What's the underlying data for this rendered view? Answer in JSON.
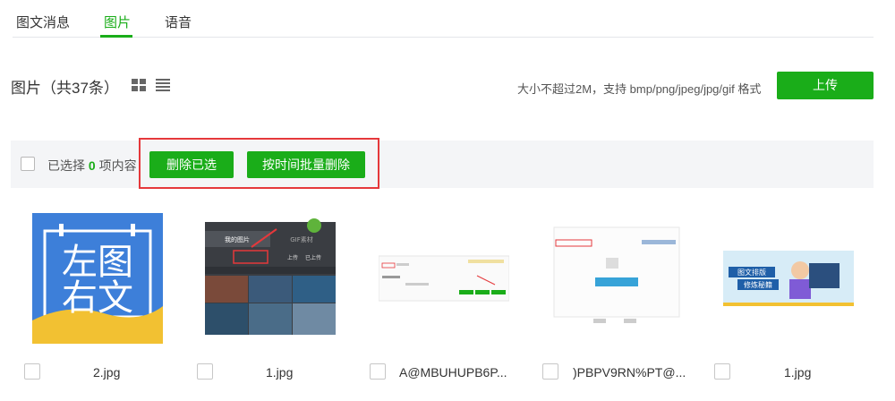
{
  "tabs": [
    {
      "label": "图文消息"
    },
    {
      "label": "图片"
    },
    {
      "label": "语音"
    }
  ],
  "active_tab": "图片",
  "header": {
    "title": "图片（共37条）",
    "hint": "大小不超过2M，支持 bmp/png/jpeg/jpg/gif 格式",
    "upload_label": "上传"
  },
  "selection_bar": {
    "prefix": "已选择 ",
    "count": "0",
    "suffix": " 项内容",
    "delete_selected_label": "删除已选",
    "batch_delete_label": "按时间批量删除"
  },
  "thumbs": {
    "t1": {
      "line1": "左图",
      "line2": "右文"
    },
    "t2": {
      "tab1": "我的图片",
      "tab2": "GIF素材",
      "action": "上传",
      "action2": "已上传"
    },
    "t5": {
      "line1": "图文排版",
      "line2": "修炼秘籍"
    }
  },
  "items": [
    {
      "name": "2.jpg"
    },
    {
      "name": "1.jpg"
    },
    {
      "name": "A@MBUHUPB6P..."
    },
    {
      "name": ")PBPV9RN%PT@..."
    },
    {
      "name": "1.jpg"
    }
  ],
  "colors": {
    "accent": "#1aad19",
    "highlight": "#e5383b"
  }
}
